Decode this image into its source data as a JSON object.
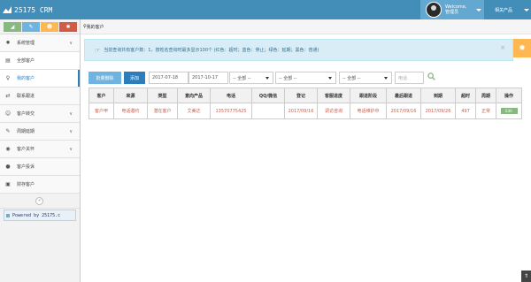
{
  "app": {
    "title": "25175 CRM"
  },
  "navbar": {
    "user": {
      "greeting": "Welcome,",
      "name": "管理员"
    },
    "product_menu": "相关产品"
  },
  "sidebar": {
    "shortcuts": [
      {
        "icon": "signal-icon",
        "color": "#87b87f"
      },
      {
        "icon": "pencil-icon",
        "color": "#6fb3e0"
      },
      {
        "icon": "users-icon",
        "color": "#ffb752"
      },
      {
        "icon": "cogs-icon",
        "color": "#d15b47"
      }
    ],
    "items": [
      {
        "label": "系统管理",
        "icon": "gear-icon",
        "arrow": "chevron-down-icon"
      },
      {
        "label": "全部客户",
        "icon": "list-icon"
      },
      {
        "label": "我的客户",
        "icon": "lightbulb-icon"
      },
      {
        "label": "联系跟进",
        "icon": "exchange-icon"
      },
      {
        "label": "客户转交",
        "icon": "user-transfer-icon",
        "arrow": "chevron-down-icon"
      },
      {
        "label": "周期延期",
        "icon": "edit-icon",
        "arrow": "chevron-down-icon"
      },
      {
        "label": "客户关怀",
        "icon": "eye-icon",
        "arrow": "chevron-down-icon"
      },
      {
        "label": "客户投诉",
        "icon": "comment-icon"
      },
      {
        "label": "财存客户",
        "icon": "save-icon"
      }
    ],
    "collapse": "«",
    "powered_by": "Powered by 25175.c"
  },
  "breadcrumb": {
    "current": "我的客户"
  },
  "alert": {
    "text": "当前查询共有客户数：1，按姓名查询时最多显示100个 (红色：超时；蓝色：停止；绿色：延期；黑色：普通)",
    "close": "×"
  },
  "toolbar": {
    "batch_delete": "批量删除",
    "add": "添加",
    "date_start": "2017-07-18",
    "date_end": "2017-10-17",
    "select_placeholder": "-- 全部 --",
    "phone_placeholder": "电话"
  },
  "table": {
    "headers": [
      "客户",
      "来源",
      "类型",
      "意向产品",
      "电话",
      "QQ/微信",
      "登记",
      "客服进度",
      "跟进阶段",
      "最后跟进",
      "到期",
      "超时",
      "周期",
      "操作"
    ],
    "rows": [
      [
        "客户甲",
        "电话邀约",
        "潜在客户",
        "艾美达",
        "13570775425",
        "",
        "2017/09/16",
        "调访咨询",
        "电话维护中",
        "2017/09/16",
        "2017/09/26",
        "497",
        "正常"
      ]
    ],
    "action_label": "Edit"
  },
  "colors": {
    "navbar": "#438eb9",
    "accent": "#2b7dbc",
    "alert_bg": "#d9edf7",
    "overdue_red": "#d15b47"
  }
}
